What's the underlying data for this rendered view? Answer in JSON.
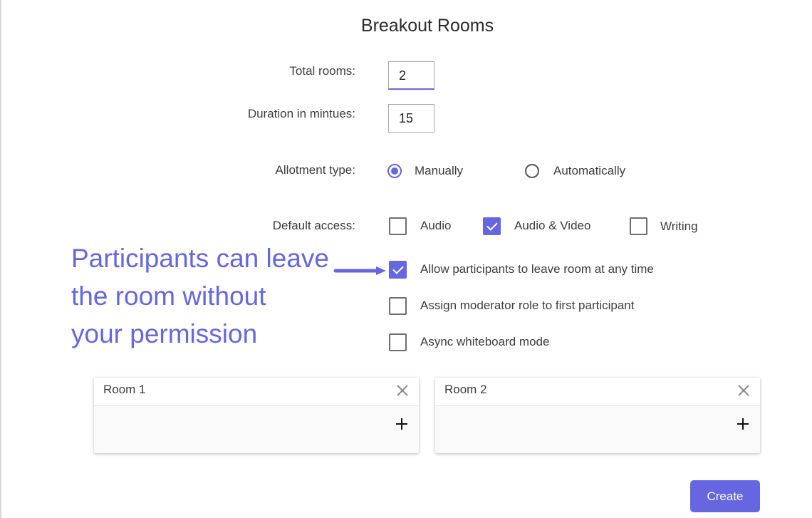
{
  "dialog": {
    "title": "Breakout Rooms"
  },
  "form": {
    "total_rooms": {
      "label": "Total rooms:",
      "value": "2"
    },
    "duration": {
      "label": "Duration in mintues:",
      "value": "15"
    },
    "allotment": {
      "label": "Allotment type:",
      "options": [
        {
          "label": "Manually",
          "checked": true
        },
        {
          "label": "Automatically",
          "checked": false
        }
      ]
    },
    "default_access": {
      "label": "Default access:",
      "options": [
        {
          "label": "Audio",
          "checked": false
        },
        {
          "label": "Audio & Video",
          "checked": true
        },
        {
          "label": "Writing",
          "checked": false
        }
      ]
    },
    "settings": [
      {
        "label": "Allow participants to leave room at any time",
        "checked": true
      },
      {
        "label": "Assign moderator role to first participant",
        "checked": false
      },
      {
        "label": "Async whiteboard mode",
        "checked": false
      }
    ]
  },
  "annotation": {
    "text": "Participants can leave\nthe room without\nyour permission",
    "color": "#6666e0"
  },
  "rooms": [
    {
      "name": "Room 1"
    },
    {
      "name": "Room 2"
    }
  ],
  "actions": {
    "create_label": "Create"
  },
  "colors": {
    "accent": "#6666e0"
  }
}
